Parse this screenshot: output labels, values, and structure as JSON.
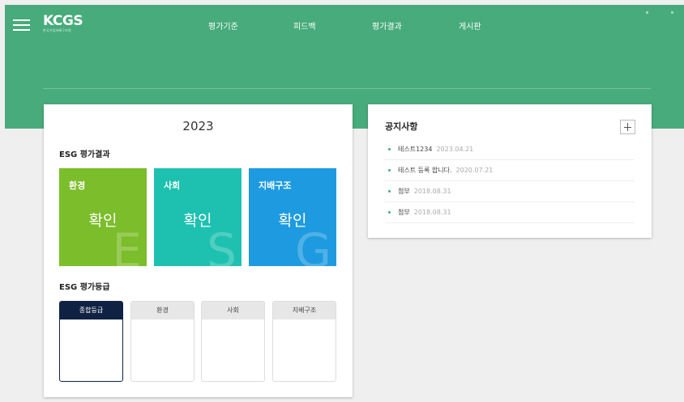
{
  "header": {
    "logo": "KCGS",
    "logo_sub": "한국기업지배구조원",
    "nav": [
      {
        "label": "평가기준"
      },
      {
        "label": "피드백"
      },
      {
        "label": "평가결과"
      },
      {
        "label": "게시판"
      }
    ]
  },
  "colors": {
    "brand_green": "#47ab7b",
    "env": "#7bbd2a",
    "social": "#1ec1b0",
    "governance": "#1e9be0",
    "grade_active": "#0f2244"
  },
  "main": {
    "year": "2023",
    "results_title": "ESG 평가결과",
    "tiles": [
      {
        "label": "환경",
        "letter": "E",
        "button": "확인"
      },
      {
        "label": "사회",
        "letter": "S",
        "button": "확인"
      },
      {
        "label": "지배구조",
        "letter": "G",
        "button": "확인"
      }
    ],
    "grades_title": "ESG 평가등급",
    "grade_tabs": [
      {
        "label": "종합등급",
        "active": true
      },
      {
        "label": "환경",
        "active": false
      },
      {
        "label": "사회",
        "active": false
      },
      {
        "label": "지배구조",
        "active": false
      }
    ]
  },
  "notice": {
    "title": "공지사항",
    "more_icon": "plus-icon",
    "items": [
      {
        "title": "테스트1234",
        "date": "2023.04.21"
      },
      {
        "title": "테스트 등록 합니다.",
        "date": "2020.07.21"
      },
      {
        "title": "첨부",
        "date": "2018.08.31"
      },
      {
        "title": "첨부",
        "date": "2018.08.31"
      }
    ]
  }
}
